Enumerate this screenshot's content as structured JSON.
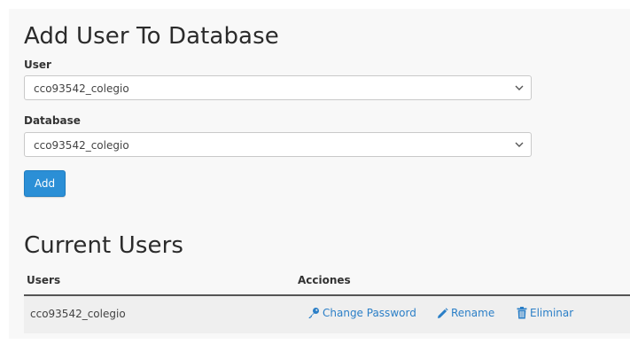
{
  "add_user": {
    "title": "Add User To Database",
    "user_label": "User",
    "user_value": "cco93542_colegio",
    "database_label": "Database",
    "database_value": "cco93542_colegio",
    "add_button": "Add"
  },
  "current_users": {
    "title": "Current Users",
    "col_users": "Users",
    "col_actions": "Acciones",
    "rows": [
      {
        "user": "cco93542_colegio",
        "change_password": "Change Password",
        "rename": "Rename",
        "delete": "Eliminar"
      }
    ]
  },
  "colors": {
    "accent": "#2b8fd6",
    "link": "#2b7fc7"
  }
}
